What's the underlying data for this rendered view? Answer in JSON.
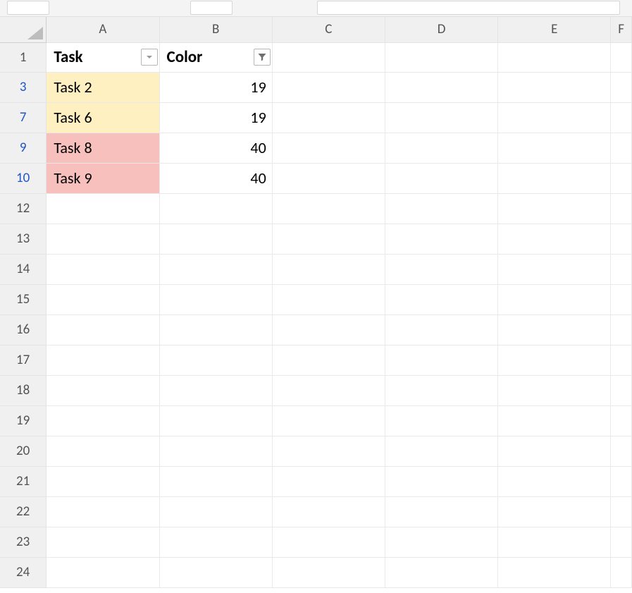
{
  "columns": [
    "A",
    "B",
    "C",
    "D",
    "E",
    "F"
  ],
  "headerRow": {
    "row": "1",
    "A": "Task",
    "B": "Color",
    "A_filter": "dropdown",
    "B_filter": "active"
  },
  "dataRows": [
    {
      "row": "3",
      "A": "Task 2",
      "B": "19",
      "A_fill": "yellow",
      "filtered": true
    },
    {
      "row": "7",
      "A": "Task 6",
      "B": "19",
      "A_fill": "yellow",
      "filtered": true
    },
    {
      "row": "9",
      "A": "Task 8",
      "B": "40",
      "A_fill": "red",
      "filtered": true
    },
    {
      "row": "10",
      "A": "Task 9",
      "B": "40",
      "A_fill": "red",
      "filtered": true
    }
  ],
  "emptyRows": [
    "12",
    "13",
    "14",
    "15",
    "16",
    "17",
    "18",
    "19",
    "20",
    "21",
    "22",
    "23",
    "24"
  ]
}
